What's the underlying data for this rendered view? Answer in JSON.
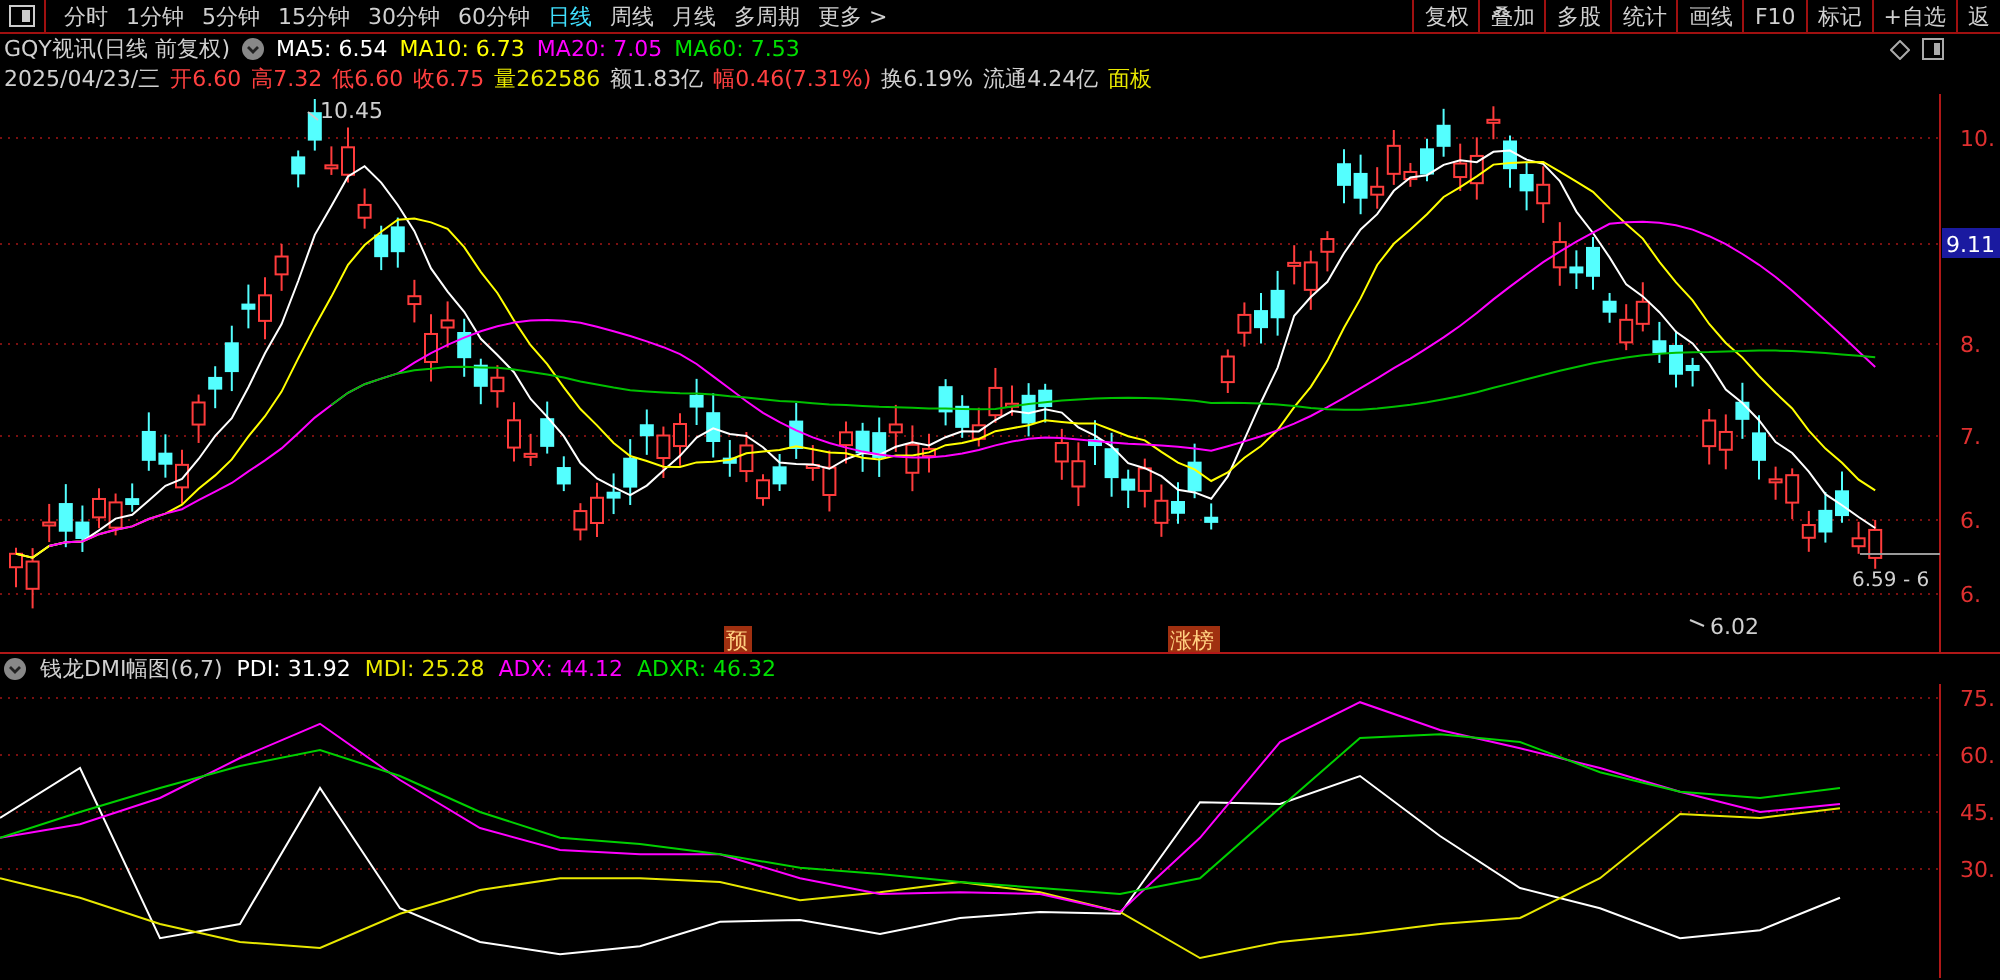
{
  "toolbar": {
    "tabs": [
      {
        "label": "分时",
        "selected": false
      },
      {
        "label": "1分钟",
        "selected": false
      },
      {
        "label": "5分钟",
        "selected": false
      },
      {
        "label": "15分钟",
        "selected": false
      },
      {
        "label": "30分钟",
        "selected": false
      },
      {
        "label": "60分钟",
        "selected": false
      },
      {
        "label": "日线",
        "selected": true
      },
      {
        "label": "周线",
        "selected": false
      },
      {
        "label": "月线",
        "selected": false
      },
      {
        "label": "多周期",
        "selected": false
      },
      {
        "label": "更多 >",
        "selected": false
      }
    ],
    "buttons": [
      "复权",
      "叠加",
      "多股",
      "统计",
      "画线",
      "F10",
      "标记",
      "+自选",
      "返"
    ]
  },
  "quote": {
    "title": "GQY视讯(日线 前复权)",
    "averages": [
      {
        "text": "MA5: 6.54",
        "color": "#ffffff"
      },
      {
        "text": "MA10: 6.73",
        "color": "#ffff00"
      },
      {
        "text": "MA20: 7.05",
        "color": "#ff00ff"
      },
      {
        "text": "MA60: 7.53",
        "color": "#00e000"
      }
    ],
    "info": [
      {
        "text": "2025/04/23/三",
        "color": "#d0d0d0"
      },
      {
        "text": "开6.60",
        "color": "#ff4040"
      },
      {
        "text": "高7.32",
        "color": "#ff4040"
      },
      {
        "text": "低6.60",
        "color": "#ff4040"
      },
      {
        "text": "收6.75",
        "color": "#ff4040"
      },
      {
        "text": "量262586",
        "color": "#e8e800"
      },
      {
        "text": "额1.83亿",
        "color": "#d0d0d0"
      },
      {
        "text": "幅0.46(7.31%)",
        "color": "#ff4040"
      },
      {
        "text": "换6.19%",
        "color": "#d0d0d0"
      },
      {
        "text": "流通4.24亿",
        "color": "#d0d0d0"
      },
      {
        "text": "面板",
        "color": "#e8e800"
      }
    ]
  },
  "main_chart": {
    "axis": [
      {
        "label": "10.",
        "kind": "tick"
      },
      {
        "label": "9.11",
        "kind": "current"
      },
      {
        "label": "8.",
        "kind": "tick"
      },
      {
        "label": "7.",
        "kind": "tick"
      },
      {
        "label": "6.",
        "kind": "tick"
      },
      {
        "label": "6.",
        "kind": "tick"
      }
    ],
    "high_label": "10.45",
    "low_label": "6.02",
    "last_label": "6.59 - 6",
    "markers": [
      "预",
      "涨榜"
    ]
  },
  "indicator": {
    "title": "钱龙DMI幅图(6,7)",
    "values": [
      {
        "text": "PDI: 31.92",
        "color": "#ffffff"
      },
      {
        "text": "MDI: 25.28",
        "color": "#e8e800"
      },
      {
        "text": "ADX: 44.12",
        "color": "#ff00ff"
      },
      {
        "text": "ADXR: 46.32",
        "color": "#00e000"
      }
    ],
    "chart_data": {
      "type": "line",
      "ylim": [
        0,
        80
      ],
      "grid": true,
      "yticks": [
        {
          "value": 75,
          "label": "75."
        },
        {
          "value": 60,
          "label": "60."
        },
        {
          "value": 45,
          "label": "45."
        },
        {
          "value": 30,
          "label": "30."
        }
      ],
      "series": [
        {
          "color": "#ffffff",
          "values": [
            43.4,
            56.6,
            11.8,
            15.5,
            51.3,
            19.7,
            10.8,
            7.6,
            9.7,
            16.1,
            16.6,
            12.9,
            17.1,
            18.7,
            18.2,
            47.6,
            47.1,
            54.5,
            38.7,
            25,
            19.7,
            11.8,
            13.9,
            22.4
          ]
        },
        {
          "color": "#e8e800",
          "values": [
            27.6,
            22.4,
            15.5,
            10.8,
            9.2,
            18.2,
            24.5,
            27.6,
            27.6,
            26.6,
            21.8,
            23.9,
            26.6,
            23.9,
            18.7,
            6.6,
            10.8,
            12.9,
            15.5,
            17.1,
            27.6,
            44.5,
            43.4,
            46
          ]
        },
        {
          "color": "#ff00ff",
          "values": [
            38.2,
            41.8,
            48.7,
            59.2,
            68.2,
            53.4,
            40.8,
            35,
            33.9,
            33.9,
            27.6,
            23.4,
            23.9,
            23.4,
            18.7,
            38.2,
            63.4,
            73.9,
            66.6,
            61.8,
            56.6,
            50.3,
            45,
            47.1
          ]
        },
        {
          "color": "#00d000",
          "values": [
            38.2,
            45,
            51.3,
            57.1,
            61.3,
            54.5,
            45,
            38.2,
            36.6,
            33.9,
            30.3,
            28.7,
            26.6,
            25,
            23.4,
            27.6,
            46.1,
            64.5,
            65.5,
            63.4,
            55.5,
            50.3,
            48.7,
            51.3
          ]
        }
      ]
    }
  }
}
